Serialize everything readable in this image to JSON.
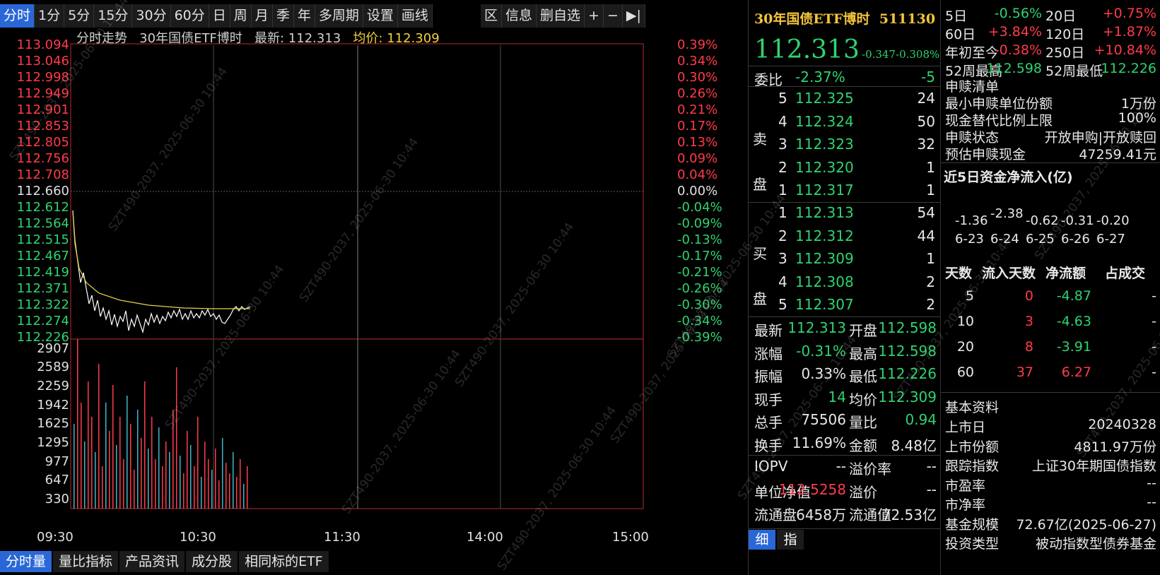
{
  "toolbar": {
    "items": [
      "分时",
      "1分",
      "5分",
      "15分",
      "30分",
      "60分",
      "日",
      "周",
      "月",
      "季",
      "年",
      "多周期",
      "设置",
      "画线"
    ],
    "right_items": [
      "区",
      "信息",
      "删自选",
      "+",
      "−",
      "▶|"
    ]
  },
  "chart": {
    "title_prefix": "分时走势",
    "title_name": "30年国债ETF博时",
    "latest_label": "最新:",
    "latest_value": "112.313",
    "avg_label": "均价:",
    "avg_value": "112.309",
    "price_ticks": [
      "113.094",
      "113.046",
      "112.998",
      "112.949",
      "112.901",
      "112.853",
      "112.805",
      "112.756",
      "112.708",
      "112.660",
      "112.612",
      "112.564",
      "112.515",
      "112.467",
      "112.419",
      "112.371",
      "112.322",
      "112.274",
      "112.226"
    ],
    "pct_ticks": [
      "0.39%",
      "0.34%",
      "0.30%",
      "0.26%",
      "0.21%",
      "0.17%",
      "0.13%",
      "0.09%",
      "0.04%",
      "0.00%",
      "-0.04%",
      "-0.09%",
      "-0.13%",
      "-0.17%",
      "-0.21%",
      "-0.26%",
      "-0.30%",
      "-0.34%",
      "-0.39%"
    ],
    "volume_ticks": [
      "2907",
      "2589",
      "2259",
      "1942",
      "1625",
      "1295",
      "977",
      "647",
      "330"
    ],
    "time_ticks": [
      "09:30",
      "10:30",
      "11:30",
      "14:00",
      "15:00"
    ],
    "colors": {
      "up": "#ff3b4a",
      "down": "#2fd36f",
      "price_line": "#ffffff",
      "avg_line": "#e6d24a",
      "grid": "#5a1a1a",
      "volume_up": "#ff3b4a",
      "volume_down": "#3fb6c8"
    }
  },
  "bottom_tabs": [
    "分时量",
    "量比指标",
    "产品资讯",
    "成分股",
    "相同标的ETF"
  ],
  "quote": {
    "name": "30年国债ETF博时",
    "code": "511130",
    "price": "112.313",
    "change": "-0.347",
    "change_pct": "-0.308%",
    "weibi_label": "委比",
    "weibi_pct": "-2.37%",
    "weibi_diff": "-5",
    "sell_label": [
      "卖",
      "盘"
    ],
    "buy_label": [
      "买",
      "盘"
    ],
    "asks": [
      {
        "level": "5",
        "price": "112.325",
        "vol": "24"
      },
      {
        "level": "4",
        "price": "112.324",
        "vol": "50"
      },
      {
        "level": "3",
        "price": "112.323",
        "vol": "32"
      },
      {
        "level": "2",
        "price": "112.320",
        "vol": "1"
      },
      {
        "level": "1",
        "price": "112.317",
        "vol": "1"
      }
    ],
    "bids": [
      {
        "level": "1",
        "price": "112.313",
        "vol": "54"
      },
      {
        "level": "2",
        "price": "112.312",
        "vol": "44"
      },
      {
        "level": "3",
        "price": "112.309",
        "vol": "1"
      },
      {
        "level": "4",
        "price": "112.308",
        "vol": "2"
      },
      {
        "level": "5",
        "price": "112.307",
        "vol": "2"
      }
    ],
    "stats": [
      {
        "l1": "最新",
        "v1": "112.313",
        "c1": "green",
        "l2": "开盘",
        "v2": "112.598",
        "c2": "green"
      },
      {
        "l1": "涨幅",
        "v1": "-0.31%",
        "c1": "green",
        "l2": "最高",
        "v2": "112.598",
        "c2": "green"
      },
      {
        "l1": "振幅",
        "v1": "0.33%",
        "c1": "white",
        "l2": "最低",
        "v2": "112.226",
        "c2": "green"
      },
      {
        "l1": "现手",
        "v1": "14",
        "c1": "green",
        "l2": "均价",
        "v2": "112.309",
        "c2": "green"
      },
      {
        "l1": "总手",
        "v1": "75506",
        "c1": "white",
        "l2": "量比",
        "v2": "0.94",
        "c2": "green"
      },
      {
        "l1": "换手",
        "v1": "11.69%",
        "c1": "white",
        "l2": "金额",
        "v2": "8.48亿",
        "c2": "white"
      }
    ],
    "extra": [
      {
        "l1": "IOPV",
        "v1": "--",
        "c1": "white",
        "l2": "溢价率",
        "v2": "--",
        "c2": "white"
      },
      {
        "l1": "单位净值",
        "v1": "112.5258",
        "c1": "red",
        "l2": "溢价",
        "v2": "--",
        "c2": "white"
      },
      {
        "l1": "流通盘",
        "v1": "6458万",
        "c1": "white",
        "l2": "流通值",
        "v2": "72.53亿",
        "c2": "white"
      }
    ],
    "tabs": [
      "细",
      "指"
    ]
  },
  "info": {
    "periods": [
      {
        "l1": "5日",
        "v1": "-0.56%",
        "c1": "green",
        "l2": "20日",
        "v2": "+0.75%",
        "c2": "red"
      },
      {
        "l1": "60日",
        "v1": "+3.84%",
        "c1": "red",
        "l2": "120日",
        "v2": "+1.87%",
        "c2": "red"
      },
      {
        "l1": "年初至今",
        "v1": "-0.38%",
        "c1": "red",
        "l2": "250日",
        "v2": "+10.84%",
        "c2": "red"
      },
      {
        "l1": "52周最高",
        "v1": "112.598",
        "c1": "green",
        "l2": "52周最低",
        "v2": "112.226",
        "c2": "green"
      }
    ],
    "redeem_title": "申赎清单",
    "redeem": [
      {
        "label": "最小申赎单位份额",
        "value": "1万份"
      },
      {
        "label": "现金替代比例上限",
        "value": "100%"
      },
      {
        "label": "申赎状态",
        "value": "开放申购|开放赎回"
      },
      {
        "label": "预估申赎现金",
        "value": "47259.41元"
      }
    ],
    "flow_title": "近5日资金净流入(亿)",
    "flow_days": [
      {
        "date": "6-23",
        "value": "-1.36"
      },
      {
        "date": "6-24",
        "value": "-2.38"
      },
      {
        "date": "6-25",
        "value": "-0.62"
      },
      {
        "date": "6-26",
        "value": "-0.31"
      },
      {
        "date": "6-27",
        "value": "-0.20"
      }
    ],
    "flow_table": {
      "headers": [
        "天数",
        "流入天数",
        "净流额",
        "占成交"
      ],
      "rows": [
        {
          "days": "5",
          "inflow": "0",
          "net": "-4.87",
          "share": "-"
        },
        {
          "days": "10",
          "inflow": "3",
          "net": "-4.63",
          "share": "-"
        },
        {
          "days": "20",
          "inflow": "8",
          "net": "-3.91",
          "share": "-"
        },
        {
          "days": "60",
          "inflow": "37",
          "net": "6.27",
          "share": "-"
        }
      ]
    },
    "basic_title": "基本资料",
    "basic": [
      {
        "label": "上市日",
        "value": "20240328"
      },
      {
        "label": "上市份额",
        "value": "4811.97万份"
      },
      {
        "label": "跟踪指数",
        "value": "上证30年期国债指数"
      },
      {
        "label": "市盈率",
        "value": "--"
      },
      {
        "label": "市净率",
        "value": "--"
      },
      {
        "label": "基金规模",
        "value": "72.67亿(2025-06-27)"
      },
      {
        "label": "投资类型",
        "value": "被动指数型债券基金"
      }
    ]
  },
  "watermark": "SZT490-2037, 2025-06-30 10:44"
}
